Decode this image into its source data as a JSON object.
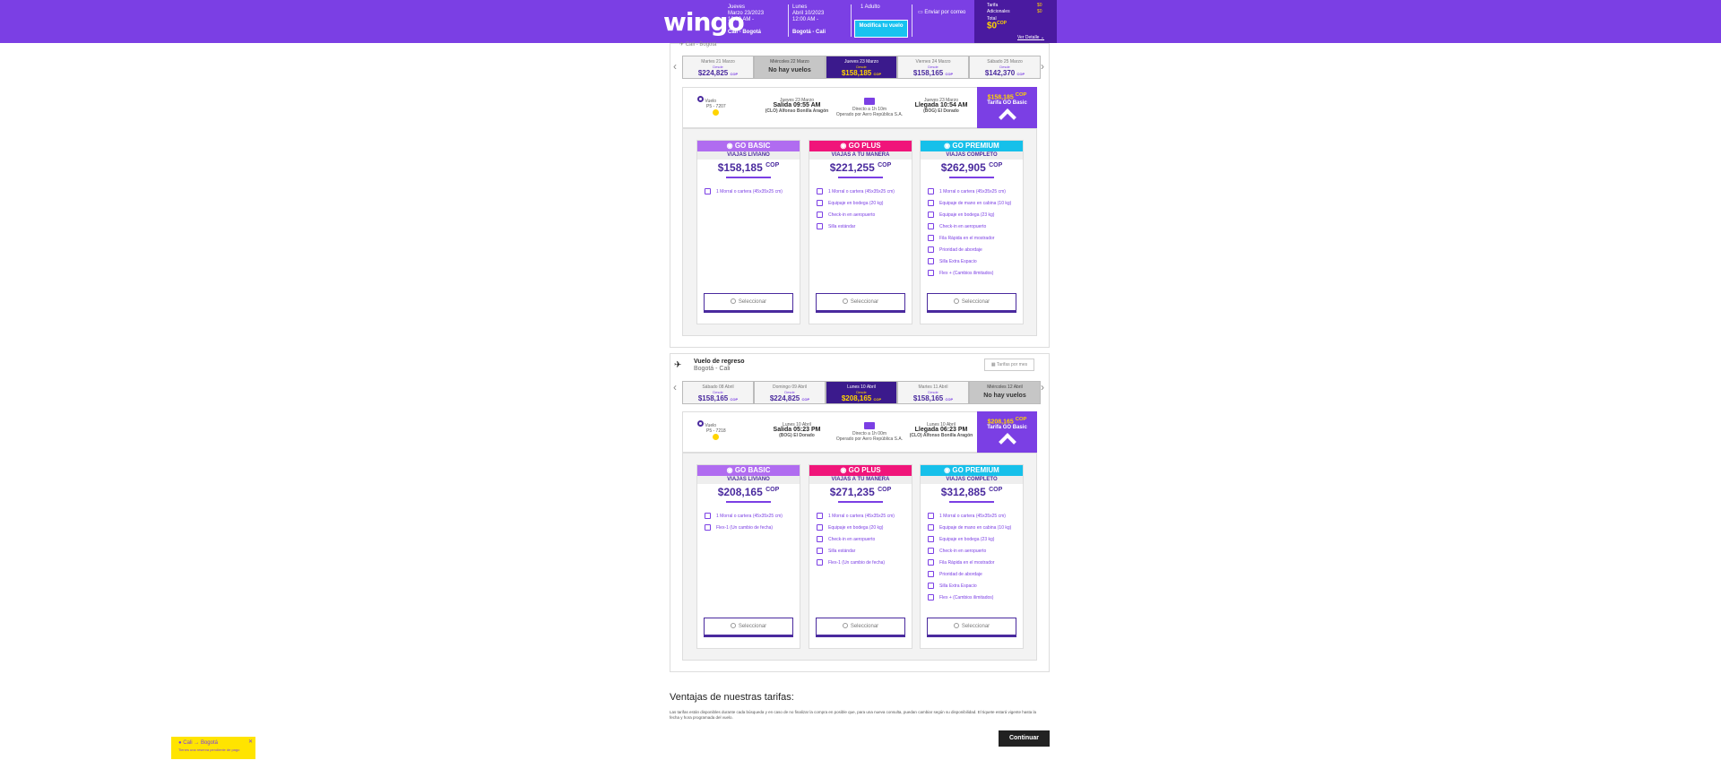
{
  "header": {
    "logo": "wingo",
    "out": {
      "day": "Jueves",
      "date": "Marzo 23/2023",
      "time": "12:00 AM -",
      "route": "Cali - Bogotá"
    },
    "ret": {
      "day": "Lunes",
      "date": "Abril 10/2023",
      "time": "12:00 AM -",
      "route": "Bogotá - Cali"
    },
    "pax": "1 Adulto",
    "modify": "Modifica tu vuelo",
    "email": "Enviar por correo",
    "summary": {
      "tarifa": "Tarifa",
      "adicionales": "Adicionales",
      "total": "Total",
      "tarifa_v": "$0",
      "adic_v": "$0",
      "total_v": "$0",
      "cop": "COP",
      "ver": "Ver Detalle"
    }
  },
  "outbound": {
    "route": "Cali - Bogotá",
    "dates": [
      {
        "label": "Martes 21 Marzo",
        "desde": "Desde",
        "price": "$224,825",
        "cop": "COP",
        "state": "normal"
      },
      {
        "label": "Miércoles 22 Marzo",
        "desde": "",
        "price": "No hay vuelos",
        "cop": "",
        "state": "none"
      },
      {
        "label": "Jueves 23 Marzo",
        "desde": "Desde",
        "price": "$158,185",
        "cop": "COP",
        "state": "sel"
      },
      {
        "label": "Viernes 24 Marzo",
        "desde": "Desde",
        "price": "$158,165",
        "cop": "COP",
        "state": "normal"
      },
      {
        "label": "Sábado 25 Marzo",
        "desde": "Desde",
        "price": "$142,370",
        "cop": "COP",
        "state": "normal"
      }
    ],
    "flight": {
      "vuelo": "Vuelo",
      "num": "P5 - 7207",
      "dep_date": "Jueves 23 Marzo",
      "dep": "Salida 09:55 AM",
      "dep_ap": "(CLO) Alfonso Bonilla Aragón",
      "mid1": "Directo a 1h 10m",
      "mid2": "Operado por Aero República S.A.",
      "arr_date": "Jueves 23 Marzo",
      "arr": "Llegada 10:54 AM",
      "arr_ap": "(BOG) El Dorado",
      "fare_price": "$158,185",
      "fare_cop": "COP",
      "fare_name": "Tarifa GO Basic"
    },
    "cards": [
      {
        "name": "GO BASIC",
        "sub": "VIAJAS LIVIANO",
        "price": "$158,185",
        "cop": "COP",
        "feats": [
          "1 Morral o cartera (45x35x25 cm)"
        ],
        "btn": "Seleccionar"
      },
      {
        "name": "GO PLUS",
        "sub": "VIAJAS A TU MANERA",
        "price": "$221,255",
        "cop": "COP",
        "feats": [
          "1 Morral o cartera (45x35x25 cm)",
          "Equipaje en bodega (20 kg)",
          "Check-in en aeropuerto",
          "Silla estándar"
        ],
        "btn": "Seleccionar"
      },
      {
        "name": "GO PREMIUM",
        "sub": "VIAJAS COMPLETO",
        "price": "$262,905",
        "cop": "COP",
        "feats": [
          "1 Morral o cartera (45x35x25 cm)",
          "Equipaje de mano en cabina (10 kg)",
          "Equipaje en bodega (23 kg)",
          "Check-in en aeropuerto",
          "Fila Rápida en el mostrador",
          "Prioridad de abordaje",
          "Silla Extra Espacio",
          "Flex + (Cambios ilimitados)"
        ],
        "btn": "Seleccionar"
      }
    ]
  },
  "return": {
    "title": "Vuelo de regreso",
    "route": "Bogotá - Cali",
    "tarifas_mes": "Tarifas por mes",
    "dates": [
      {
        "label": "Sábado 08 Abril",
        "desde": "Desde",
        "price": "$158,165",
        "cop": "COP",
        "state": "normal"
      },
      {
        "label": "Domingo 09 Abril",
        "desde": "Desde",
        "price": "$224,825",
        "cop": "COP",
        "state": "normal"
      },
      {
        "label": "Lunes 10 Abril",
        "desde": "Desde",
        "price": "$208,165",
        "cop": "COP",
        "state": "sel"
      },
      {
        "label": "Martes 11 Abril",
        "desde": "Desde",
        "price": "$158,165",
        "cop": "COP",
        "state": "normal"
      },
      {
        "label": "Miércoles 12 Abril",
        "desde": "",
        "price": "No hay vuelos",
        "cop": "",
        "state": "none"
      }
    ],
    "flight": {
      "vuelo": "Vuelo",
      "num": "P5 - 7218",
      "dep_date": "Lunes 10 Abril",
      "dep": "Salida 05:23 PM",
      "dep_ap": "(BOG) El Dorado",
      "mid1": "Directo a 1h 00m",
      "mid2": "Operado por Aero República S.A.",
      "arr_date": "Lunes 10 Abril",
      "arr": "Llegada 06:23 PM",
      "arr_ap": "(CLO) Alfonso Bonilla Aragón",
      "fare_price": "$208,165",
      "fare_cop": "COP",
      "fare_name": "Tarifa GO Basic"
    },
    "cards": [
      {
        "name": "GO BASIC",
        "sub": "VIAJAS LIVIANO",
        "price": "$208,165",
        "cop": "COP",
        "feats": [
          "1 Morral o cartera (45x35x25 cm)",
          "Flex-1 (Un cambio de fecha)"
        ],
        "btn": "Seleccionar"
      },
      {
        "name": "GO PLUS",
        "sub": "VIAJAS A TU MANERA",
        "price": "$271,235",
        "cop": "COP",
        "feats": [
          "1 Morral o cartera (45x35x25 cm)",
          "Equipaje en bodega (20 kg)",
          "Check-in en aeropuerto",
          "Silla estándar",
          "Flex-1 (Un cambio de fecha)"
        ],
        "btn": "Seleccionar"
      },
      {
        "name": "GO PREMIUM",
        "sub": "VIAJAS COMPLETO",
        "price": "$312,885",
        "cop": "COP",
        "feats": [
          "1 Morral o cartera (45x35x25 cm)",
          "Equipaje de mano en cabina (10 kg)",
          "Equipaje en bodega (23 kg)",
          "Check-in en aeropuerto",
          "Fila Rápida en el mostrador",
          "Prioridad de abordaje",
          "Silla Extra Espacio",
          "Flex + (Cambios ilimitados)"
        ],
        "btn": "Seleccionar"
      }
    ]
  },
  "advantages": {
    "title": "Ventajas de nuestras tarifas:",
    "text": "Las tarifas están disponibles durante cada búsqueda y en caso de no finalizar la compra en posible que, para una nueva consulta, puedan cambiar según su disponibilidad. El tiquete estará vigente hasta la fecha y hora programada del vuelo."
  },
  "continue": "Continuar",
  "notice": {
    "route": "Cali → Bogotá",
    "text": "Tienes una reserva pendiente de pago"
  },
  "colors": {
    "purple": "#7b3fe4",
    "basic": "#b06cf0",
    "plus": "#f0157a",
    "premium": "#16c0ea",
    "yellow": "#ffe400"
  }
}
